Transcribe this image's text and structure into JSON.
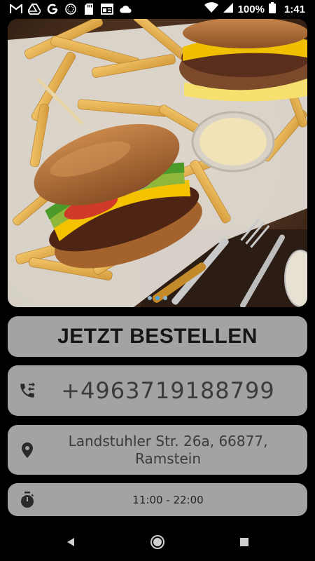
{
  "status_bar": {
    "battery": "100%",
    "time": "1:41",
    "left_icons": [
      "gmail-icon",
      "drive-icon",
      "google-icon",
      "app-icon",
      "sd-card-icon",
      "news-icon",
      "cloud-icon"
    ],
    "right_icons": [
      "wifi-icon",
      "signal-icon",
      "battery-icon"
    ]
  },
  "banner": {
    "image": "burger-and-fries-photo",
    "pages": 3,
    "active_page": 2
  },
  "order_button": {
    "label": "JETZT BESTELLEN"
  },
  "phone": {
    "icon": "phone-forward-icon",
    "number": "+4963719188799"
  },
  "address": {
    "icon": "location-pin-icon",
    "line1": "Landstuhler Str. 26a, 66877,",
    "line2": "Ramstein"
  },
  "hours": {
    "icon": "timer-icon",
    "text": "11:00 - 22:00"
  },
  "nav_bar": {
    "buttons": [
      "back-button",
      "home-button",
      "recents-button"
    ]
  },
  "colors": {
    "background": "#000000",
    "card": "#a3a3a3",
    "text_dark": "#151515",
    "text_gray": "#3b3b3b",
    "dot_active": "#4fa3e0"
  }
}
